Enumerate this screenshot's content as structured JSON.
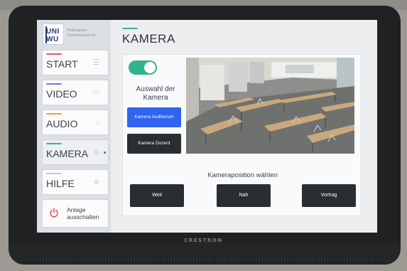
{
  "device": {
    "brand": "CRESTRON"
  },
  "logo": {
    "mark_line1": "UNI",
    "mark_line2": "WU",
    "text_line1": "Philosophie",
    "text_line2": "Seminarraum 24"
  },
  "sidebar": {
    "items": [
      {
        "label": "START",
        "stripe_color": "#e0557a",
        "icon": "list-icon",
        "glyph": "☰"
      },
      {
        "label": "VIDEO",
        "stripe_color": "#8a6fe0",
        "icon": "camcorder-icon",
        "glyph": "▭"
      },
      {
        "label": "AUDIO",
        "stripe_color": "#e8a23a",
        "icon": "microphone-icon",
        "glyph": "♪"
      },
      {
        "label": "KAMERA",
        "stripe_color": "#3ab19a",
        "icon": "camera-icon",
        "glyph": "◎",
        "active": true
      },
      {
        "label": "HILFE",
        "stripe_color": "#c4c7cc",
        "icon": "help-icon",
        "glyph": "⊚"
      }
    ],
    "power": {
      "line1": "Anlage",
      "line2": "ausschalten",
      "icon": "power-icon",
      "color": "#e04a4a"
    }
  },
  "page": {
    "title": "KAMERA",
    "accent": "#3ab19a"
  },
  "camera_select": {
    "toggle_on": true,
    "label_line1": "Auswahl der",
    "label_line2": "Kamera",
    "buttons": [
      {
        "label": "Kamera Auditorium",
        "selected": true,
        "color": "#2f63f0"
      },
      {
        "label": "Kamera Dozent",
        "selected": false,
        "color": "#2a2d31"
      }
    ]
  },
  "position": {
    "label": "Kameraposition wählen",
    "buttons": [
      "Weit",
      "Nah",
      "Vortrag"
    ]
  }
}
